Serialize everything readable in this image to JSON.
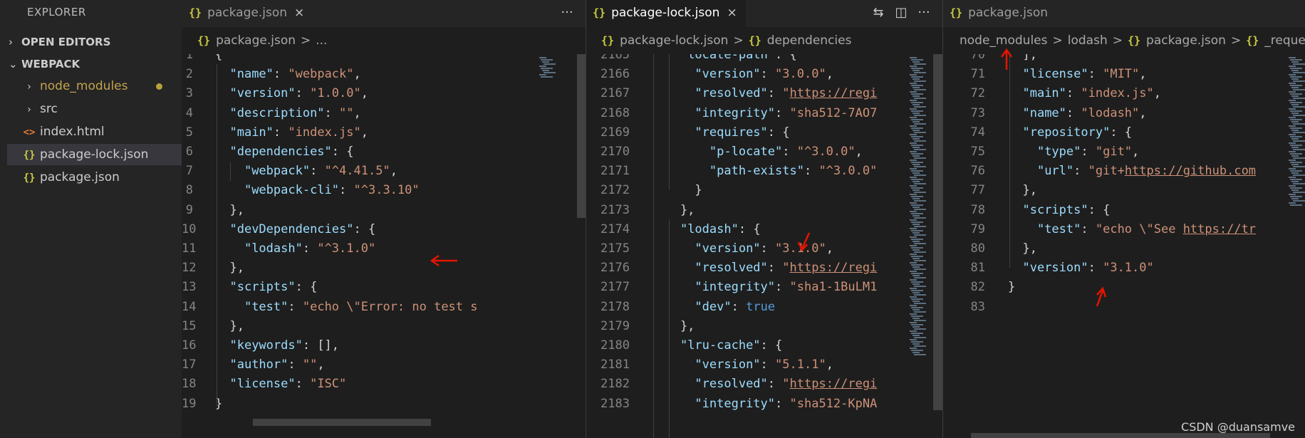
{
  "sidebar": {
    "title": "EXPLORER",
    "open_editors": "OPEN EDITORS",
    "workspace": "WEBPACK",
    "items": [
      {
        "label": "node_modules",
        "icon": "chevron-right-icon"
      },
      {
        "label": "src",
        "icon": "chevron-right-icon"
      },
      {
        "label": "index.html",
        "icon": "html-file-icon"
      },
      {
        "label": "package-lock.json",
        "icon": "json-file-icon"
      },
      {
        "label": "package.json",
        "icon": "json-file-icon"
      }
    ]
  },
  "icons": {
    "json": "{}",
    "html": "<>",
    "more": "···",
    "close": "×",
    "chev_right": "›",
    "chev_down": "⌄",
    "separator": ">"
  },
  "group1": {
    "tab": "package.json",
    "breadcrumb": [
      "package.json",
      "..."
    ],
    "lines": [
      {
        "n": "1",
        "t": [
          [
            "p",
            "{"
          ]
        ]
      },
      {
        "n": "2",
        "t": [
          [
            "p",
            "  "
          ],
          [
            "k",
            "\"name\""
          ],
          [
            "p",
            ": "
          ],
          [
            "s",
            "\"webpack\""
          ],
          [
            "p",
            ","
          ]
        ]
      },
      {
        "n": "3",
        "t": [
          [
            "p",
            "  "
          ],
          [
            "k",
            "\"version\""
          ],
          [
            "p",
            ": "
          ],
          [
            "s",
            "\"1.0.0\""
          ],
          [
            "p",
            ","
          ]
        ]
      },
      {
        "n": "4",
        "t": [
          [
            "p",
            "  "
          ],
          [
            "k",
            "\"description\""
          ],
          [
            "p",
            ": "
          ],
          [
            "s",
            "\"\""
          ],
          [
            "p",
            ","
          ]
        ]
      },
      {
        "n": "5",
        "t": [
          [
            "p",
            "  "
          ],
          [
            "k",
            "\"main\""
          ],
          [
            "p",
            ": "
          ],
          [
            "s",
            "\"index.js\""
          ],
          [
            "p",
            ","
          ]
        ]
      },
      {
        "n": "6",
        "t": [
          [
            "p",
            "  "
          ],
          [
            "k",
            "\"dependencies\""
          ],
          [
            "p",
            ": {"
          ]
        ]
      },
      {
        "n": "7",
        "t": [
          [
            "p",
            "    "
          ],
          [
            "k",
            "\"webpack\""
          ],
          [
            "p",
            ": "
          ],
          [
            "s",
            "\"^4.41.5\""
          ],
          [
            "p",
            ","
          ]
        ]
      },
      {
        "n": "8",
        "t": [
          [
            "p",
            "    "
          ],
          [
            "k",
            "\"webpack-cli\""
          ],
          [
            "p",
            ": "
          ],
          [
            "s",
            "\"^3.3.10\""
          ]
        ]
      },
      {
        "n": "9",
        "t": [
          [
            "p",
            "  },"
          ]
        ]
      },
      {
        "n": "10",
        "t": [
          [
            "p",
            "  "
          ],
          [
            "k",
            "\"devDependencies\""
          ],
          [
            "p",
            ": {"
          ]
        ]
      },
      {
        "n": "11",
        "t": [
          [
            "p",
            "    "
          ],
          [
            "k",
            "\"lodash\""
          ],
          [
            "p",
            ": "
          ],
          [
            "s",
            "\"^3.1.0\""
          ]
        ]
      },
      {
        "n": "12",
        "t": [
          [
            "p",
            "  },"
          ]
        ]
      },
      {
        "n": "13",
        "t": [
          [
            "p",
            "  "
          ],
          [
            "k",
            "\"scripts\""
          ],
          [
            "p",
            ": {"
          ]
        ]
      },
      {
        "n": "14",
        "t": [
          [
            "p",
            "    "
          ],
          [
            "k",
            "\"test\""
          ],
          [
            "p",
            ": "
          ],
          [
            "s",
            "\"echo \\\"Error: no test s"
          ]
        ]
      },
      {
        "n": "15",
        "t": [
          [
            "p",
            "  },"
          ]
        ]
      },
      {
        "n": "16",
        "t": [
          [
            "p",
            "  "
          ],
          [
            "k",
            "\"keywords\""
          ],
          [
            "p",
            ": [],"
          ]
        ]
      },
      {
        "n": "17",
        "t": [
          [
            "p",
            "  "
          ],
          [
            "k",
            "\"author\""
          ],
          [
            "p",
            ": "
          ],
          [
            "s",
            "\"\""
          ],
          [
            "p",
            ","
          ]
        ]
      },
      {
        "n": "18",
        "t": [
          [
            "p",
            "  "
          ],
          [
            "k",
            "\"license\""
          ],
          [
            "p",
            ": "
          ],
          [
            "s",
            "\"ISC\""
          ]
        ]
      },
      {
        "n": "19",
        "t": [
          [
            "p",
            "}"
          ]
        ]
      }
    ]
  },
  "group2": {
    "tab": "package-lock.json",
    "breadcrumb": [
      "package-lock.json",
      "dependencies"
    ],
    "lines": [
      {
        "n": "2165",
        "t": [
          [
            "p",
            "    "
          ],
          [
            "k",
            "\"locate-path\""
          ],
          [
            "p",
            ": {"
          ]
        ]
      },
      {
        "n": "2166",
        "t": [
          [
            "p",
            "      "
          ],
          [
            "k",
            "\"version\""
          ],
          [
            "p",
            ": "
          ],
          [
            "s",
            "\"3.0.0\""
          ],
          [
            "p",
            ","
          ]
        ]
      },
      {
        "n": "2167",
        "t": [
          [
            "p",
            "      "
          ],
          [
            "k",
            "\"resolved\""
          ],
          [
            "p",
            ": "
          ],
          [
            "s",
            "\""
          ],
          [
            "u",
            "https://regi"
          ]
        ]
      },
      {
        "n": "2168",
        "t": [
          [
            "p",
            "      "
          ],
          [
            "k",
            "\"integrity\""
          ],
          [
            "p",
            ": "
          ],
          [
            "s",
            "\"sha512-7AO7"
          ]
        ]
      },
      {
        "n": "2169",
        "t": [
          [
            "p",
            "      "
          ],
          [
            "k",
            "\"requires\""
          ],
          [
            "p",
            ": {"
          ]
        ]
      },
      {
        "n": "2170",
        "t": [
          [
            "p",
            "        "
          ],
          [
            "k",
            "\"p-locate\""
          ],
          [
            "p",
            ": "
          ],
          [
            "s",
            "\"^3.0.0\""
          ],
          [
            "p",
            ","
          ]
        ]
      },
      {
        "n": "2171",
        "t": [
          [
            "p",
            "        "
          ],
          [
            "k",
            "\"path-exists\""
          ],
          [
            "p",
            ": "
          ],
          [
            "s",
            "\"^3.0.0\""
          ]
        ]
      },
      {
        "n": "2172",
        "t": [
          [
            "p",
            "      }"
          ]
        ]
      },
      {
        "n": "2173",
        "t": [
          [
            "p",
            "    },"
          ]
        ]
      },
      {
        "n": "2174",
        "t": [
          [
            "p",
            "    "
          ],
          [
            "k",
            "\"lodash\""
          ],
          [
            "p",
            ": {"
          ]
        ]
      },
      {
        "n": "2175",
        "t": [
          [
            "p",
            "      "
          ],
          [
            "k",
            "\"version\""
          ],
          [
            "p",
            ": "
          ],
          [
            "s",
            "\"3.1.0\""
          ],
          [
            "p",
            ","
          ]
        ]
      },
      {
        "n": "2176",
        "t": [
          [
            "p",
            "      "
          ],
          [
            "k",
            "\"resolved\""
          ],
          [
            "p",
            ": "
          ],
          [
            "s",
            "\""
          ],
          [
            "u",
            "https://regi"
          ]
        ]
      },
      {
        "n": "2177",
        "t": [
          [
            "p",
            "      "
          ],
          [
            "k",
            "\"integrity\""
          ],
          [
            "p",
            ": "
          ],
          [
            "s",
            "\"sha1-1BuLM1"
          ]
        ]
      },
      {
        "n": "2178",
        "t": [
          [
            "p",
            "      "
          ],
          [
            "k",
            "\"dev\""
          ],
          [
            "p",
            ": "
          ],
          [
            "b",
            "true"
          ]
        ]
      },
      {
        "n": "2179",
        "t": [
          [
            "p",
            "    },"
          ]
        ]
      },
      {
        "n": "2180",
        "t": [
          [
            "p",
            "    "
          ],
          [
            "k",
            "\"lru-cache\""
          ],
          [
            "p",
            ": {"
          ]
        ]
      },
      {
        "n": "2181",
        "t": [
          [
            "p",
            "      "
          ],
          [
            "k",
            "\"version\""
          ],
          [
            "p",
            ": "
          ],
          [
            "s",
            "\"5.1.1\""
          ],
          [
            "p",
            ","
          ]
        ]
      },
      {
        "n": "2182",
        "t": [
          [
            "p",
            "      "
          ],
          [
            "k",
            "\"resolved\""
          ],
          [
            "p",
            ": "
          ],
          [
            "s",
            "\""
          ],
          [
            "u",
            "https://regi"
          ]
        ]
      },
      {
        "n": "2183",
        "t": [
          [
            "p",
            "      "
          ],
          [
            "k",
            "\"integrity\""
          ],
          [
            "p",
            ": "
          ],
          [
            "s",
            "\"sha512-KpNA"
          ]
        ]
      }
    ]
  },
  "group3": {
    "tab": "package.json",
    "breadcrumb": [
      "node_modules",
      "lodash",
      "package.json",
      "_request"
    ],
    "lines": [
      {
        "n": "70",
        "t": [
          [
            "p",
            "  ],"
          ]
        ]
      },
      {
        "n": "71",
        "t": [
          [
            "p",
            "  "
          ],
          [
            "k",
            "\"license\""
          ],
          [
            "p",
            ": "
          ],
          [
            "s",
            "\"MIT\""
          ],
          [
            "p",
            ","
          ]
        ]
      },
      {
        "n": "72",
        "t": [
          [
            "p",
            "  "
          ],
          [
            "k",
            "\"main\""
          ],
          [
            "p",
            ": "
          ],
          [
            "s",
            "\"index.js\""
          ],
          [
            "p",
            ","
          ]
        ]
      },
      {
        "n": "73",
        "t": [
          [
            "p",
            "  "
          ],
          [
            "k",
            "\"name\""
          ],
          [
            "p",
            ": "
          ],
          [
            "s",
            "\"lodash\""
          ],
          [
            "p",
            ","
          ]
        ]
      },
      {
        "n": "74",
        "t": [
          [
            "p",
            "  "
          ],
          [
            "k",
            "\"repository\""
          ],
          [
            "p",
            ": {"
          ]
        ]
      },
      {
        "n": "75",
        "t": [
          [
            "p",
            "    "
          ],
          [
            "k",
            "\"type\""
          ],
          [
            "p",
            ": "
          ],
          [
            "s",
            "\"git\""
          ],
          [
            "p",
            ","
          ]
        ]
      },
      {
        "n": "76",
        "t": [
          [
            "p",
            "    "
          ],
          [
            "k",
            "\"url\""
          ],
          [
            "p",
            ": "
          ],
          [
            "s",
            "\"git+"
          ],
          [
            "u",
            "https://github.com"
          ]
        ]
      },
      {
        "n": "77",
        "t": [
          [
            "p",
            "  },"
          ]
        ]
      },
      {
        "n": "78",
        "t": [
          [
            "p",
            "  "
          ],
          [
            "k",
            "\"scripts\""
          ],
          [
            "p",
            ": {"
          ]
        ]
      },
      {
        "n": "79",
        "t": [
          [
            "p",
            "    "
          ],
          [
            "k",
            "\"test\""
          ],
          [
            "p",
            ": "
          ],
          [
            "s",
            "\"echo \\\"See "
          ],
          [
            "u",
            "https://tr"
          ]
        ]
      },
      {
        "n": "80",
        "t": [
          [
            "p",
            "  },"
          ]
        ]
      },
      {
        "n": "81",
        "t": [
          [
            "p",
            "  "
          ],
          [
            "k",
            "\"version\""
          ],
          [
            "p",
            ": "
          ],
          [
            "s",
            "\"3.1.0\""
          ]
        ]
      },
      {
        "n": "82",
        "t": [
          [
            "p",
            "}"
          ]
        ]
      },
      {
        "n": "83",
        "t": []
      }
    ]
  },
  "colors": {
    "key": "#9cdcfe",
    "string": "#ce9178",
    "punct": "#d4d4d4",
    "bool": "#569cd6",
    "arrow": "#e51400",
    "json_icon": "#cbcb41"
  },
  "watermark": "CSDN @duansamve"
}
